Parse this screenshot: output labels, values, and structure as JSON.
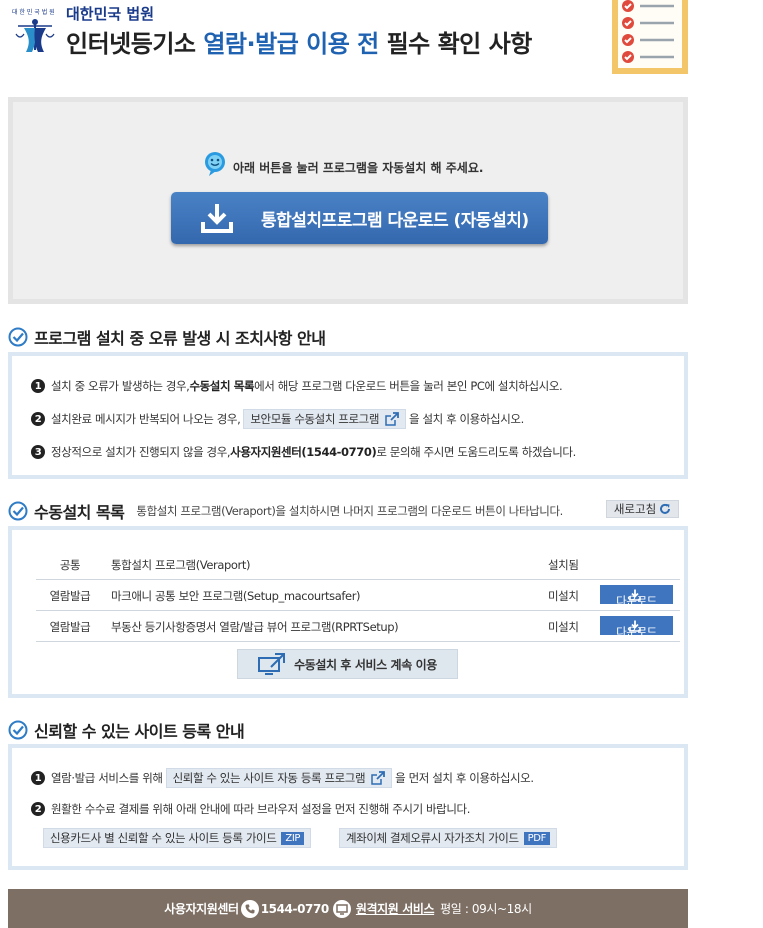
{
  "header": {
    "court_name": "대한민국 법원",
    "emblem_caption": "대 한 민 국 법 원",
    "title_prefix": "인터넷등기소 ",
    "title_accent": "열람·발급 이용 전",
    "title_suffix": " 필수 확인 사항"
  },
  "download": {
    "hint": "아래 버튼을 눌러 프로그램을 자동설치 해 주세요.",
    "button_label": "통합설치프로그램 다운로드 (자동설치)"
  },
  "error_section": {
    "title": "프로그램 설치 중 오류 발생 시 조치사항 안내",
    "item1": {
      "num": "1",
      "pre": "설치 중 오류가 발생하는 경우, ",
      "bold": "수동설치 목록",
      "post": "에서 해당 프로그램 다운로드 버튼을 눌러 본인 PC에 설치하십시오."
    },
    "item2": {
      "num": "2",
      "pre": "설치완료 메시지가 반복되어 나오는 경우,",
      "button": "보안모듈 수동설치 프로그램",
      "post": "을 설치 후 이용하십시오."
    },
    "item3": {
      "num": "3",
      "pre": "정상적으로 설치가 진행되지 않을 경우, ",
      "bold": "사용자지원센터(1544-0770)",
      "post": "로 문의해 주시면 도움드리도록 하겠습니다."
    }
  },
  "manual_section": {
    "title": "수동설치 목록",
    "desc": "통합설치 프로그램(Veraport)을 설치하시면 나머지 프로그램의 다운로드 버튼이 나타납니다.",
    "refresh_label": "새로고침",
    "rows": [
      {
        "category": "공통",
        "name": "통합설치 프로그램(Veraport)",
        "status": "설치됨",
        "action": ""
      },
      {
        "category": "열람발급",
        "name": "마크애니 공통 보안 프로그램(Setup_macourtsafer)",
        "status": "미설치",
        "action": "다운로드"
      },
      {
        "category": "열람발급",
        "name": "부동산 등기사항증명서 열람/발급 뷰어 프로그램(RPRTSetup)",
        "status": "미설치",
        "action": "다운로드"
      }
    ],
    "continue_label": "수동설치 후 서비스 계속 이용"
  },
  "trust_section": {
    "title": "신뢰할 수 있는 사이트 등록 안내",
    "item1": {
      "num": "1",
      "pre": "열람·발급 서비스를 위해",
      "button": "신뢰할 수 있는 사이트 자동 등록 프로그램",
      "post": "을 먼저 설치 후 이용하십시오."
    },
    "item2": {
      "num": "2",
      "text": "원활한 수수료 결제를 위해 아래 안내에 따라 브라우저 설정을 먼저 진행해 주시기 바랍니다."
    },
    "guide1": {
      "label": "신용카드사 별 신뢰할 수 있는 사이트 등록 가이드",
      "tag": "ZIP"
    },
    "guide2": {
      "label": "계좌이체 결제오류시 자가조치 가이드",
      "tag": "PDF"
    }
  },
  "footer": {
    "support_label": "사용자지원센터",
    "phone": "1544-0770",
    "remote_label": "원격지원 서비스",
    "hours": "평일 : 09시~18시"
  },
  "colors": {
    "accent": "#1f62b1",
    "button_blue": "#3f74bf",
    "box_border": "#dbe7f3",
    "footer_bg": "#7d6f63"
  }
}
